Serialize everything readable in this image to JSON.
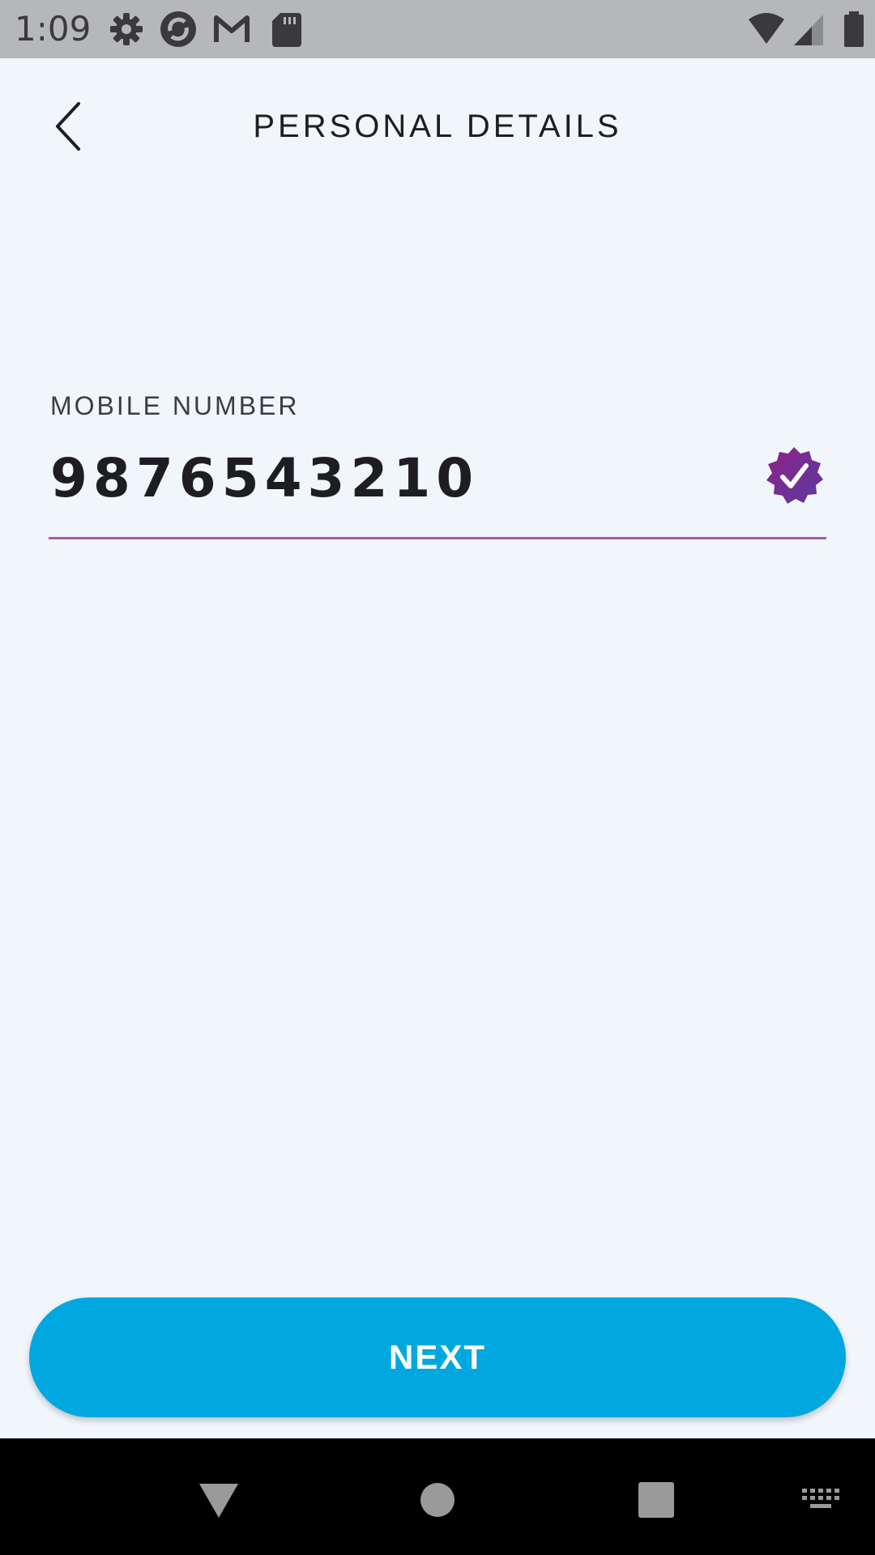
{
  "status_bar": {
    "time": "1:09",
    "icons": [
      "settings-icon",
      "sync-icon",
      "gmail-icon",
      "sd-card-icon",
      "wifi-icon",
      "cell-signal-icon",
      "battery-icon"
    ]
  },
  "header": {
    "title": "PERSONAL DETAILS",
    "back_icon": "chevron-left-icon"
  },
  "form": {
    "mobile_label": "MOBILE NUMBER",
    "mobile_value": "9876543210",
    "verified_icon": "verified-badge-icon"
  },
  "actions": {
    "next_label": "NEXT"
  },
  "nav_bar": {
    "icons": [
      "back-triangle-icon",
      "home-circle-icon",
      "recents-square-icon",
      "keyboard-icon"
    ]
  },
  "colors": {
    "background": "#f1f6fb",
    "status_bar": "#b5b7bb",
    "accent_button": "#00a8df",
    "underline": "#a55ab4",
    "badge_purple": "#7a2d8f"
  }
}
